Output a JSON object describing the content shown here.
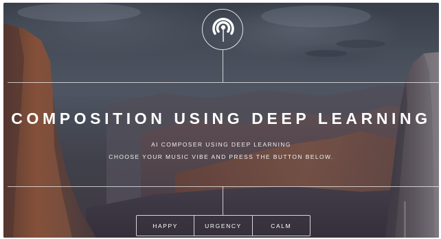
{
  "hero": {
    "title": "COMPOSITION USING DEEP LEARNING",
    "subtitle_line1": "AI COMPOSER USING DEEP LEARNING",
    "subtitle_line2": "CHOOSE YOUR MUSIC VIBE AND PRESS THE BUTTON BELOW."
  },
  "logo": {
    "icon": "signal-waves-icon"
  },
  "vibe_buttons": [
    {
      "label": "HAPPY"
    },
    {
      "label": "URGENCY"
    },
    {
      "label": "CALM"
    }
  ],
  "colors": {
    "text": "#ffffff",
    "lines": "#ffffff",
    "rock_warm": "#9a5a3c",
    "sky": "#515a67"
  }
}
